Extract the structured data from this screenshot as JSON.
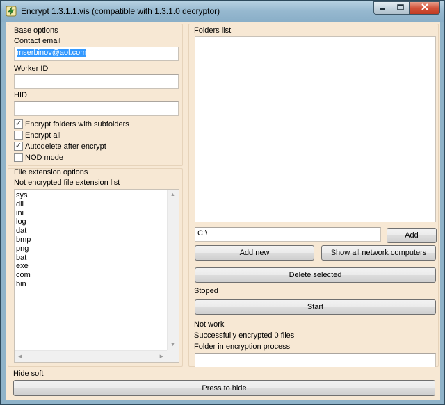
{
  "window": {
    "title": "Encrypt 1.3.1.1.vis (compatible with 1.3.1.0 decryptor)",
    "icons": {
      "app": "lightning-app-icon",
      "minimize": "minimize-icon",
      "maximize": "maximize-icon",
      "close": "close-icon"
    }
  },
  "base_options": {
    "group_label": "Base options",
    "contact_email_label": "Contact email",
    "contact_email_value": "mserbinov@aol.com",
    "worker_id_label": "Worker ID",
    "worker_id_value": "",
    "hid_label": "HID",
    "hid_value": "",
    "checkboxes": [
      {
        "label": "Encrypt folders with subfolders",
        "checked": true
      },
      {
        "label": "Encrypt all",
        "checked": false
      },
      {
        "label": "Autodelete after encrypt",
        "checked": true
      },
      {
        "label": "NOD mode",
        "checked": false
      }
    ]
  },
  "file_extension_options": {
    "group_label": "File extension options",
    "list_label": "Not encrypted file extension list",
    "extensions": [
      "sys",
      "dll",
      "ini",
      "log",
      "dat",
      "bmp",
      "png",
      "bat",
      "exe",
      "com",
      "bin"
    ]
  },
  "folders": {
    "group_label": "Folders list",
    "path_value": "C:\\",
    "add_label": "Add",
    "add_new_label": "Add new",
    "show_network_label": "Show all network computers",
    "delete_selected_label": "Delete selected",
    "state_label": "Stoped",
    "start_label": "Start",
    "work_status": "Not work",
    "encrypted_count_text": "Successfully encrypted 0 files",
    "folder_in_process_label": "Folder in encryption process",
    "folder_in_process_value": ""
  },
  "hide": {
    "label": "Hide soft",
    "button_label": "Press to hide"
  }
}
